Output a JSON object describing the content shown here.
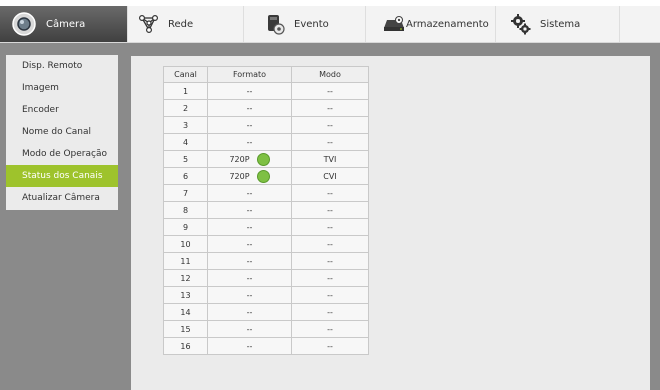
{
  "colors": {
    "accent": "#9ec32c",
    "status_ok": "#7ec043",
    "active_tab": "#4a4a4a"
  },
  "nav": [
    {
      "label": "Câmera",
      "icon": "camera-icon",
      "active": true
    },
    {
      "label": "Rede",
      "icon": "network-icon"
    },
    {
      "label": "Evento",
      "icon": "event-icon"
    },
    {
      "label": "Armazenamento",
      "icon": "storage-icon"
    },
    {
      "label": "Sistema",
      "icon": "gear-icon"
    }
  ],
  "sidebar": {
    "items": [
      {
        "label": "Disp. Remoto"
      },
      {
        "label": "Imagem"
      },
      {
        "label": "Encoder"
      },
      {
        "label": "Nome do Canal"
      },
      {
        "label": "Modo de Operação"
      },
      {
        "label": "Status dos Canais",
        "active": true
      },
      {
        "label": "Atualizar Câmera"
      }
    ]
  },
  "table": {
    "headers": [
      "Canal",
      "Formato",
      "Modo"
    ],
    "rows": [
      {
        "canal": "1",
        "formato": "--",
        "modo": "--"
      },
      {
        "canal": "2",
        "formato": "--",
        "modo": "--"
      },
      {
        "canal": "3",
        "formato": "--",
        "modo": "--"
      },
      {
        "canal": "4",
        "formato": "--",
        "modo": "--"
      },
      {
        "canal": "5",
        "formato": "720P",
        "modo": "TVI",
        "status": "ok"
      },
      {
        "canal": "6",
        "formato": "720P",
        "modo": "CVI",
        "status": "ok"
      },
      {
        "canal": "7",
        "formato": "--",
        "modo": "--"
      },
      {
        "canal": "8",
        "formato": "--",
        "modo": "--"
      },
      {
        "canal": "9",
        "formato": "--",
        "modo": "--"
      },
      {
        "canal": "10",
        "formato": "--",
        "modo": "--"
      },
      {
        "canal": "11",
        "formato": "--",
        "modo": "--"
      },
      {
        "canal": "12",
        "formato": "--",
        "modo": "--"
      },
      {
        "canal": "13",
        "formato": "--",
        "modo": "--"
      },
      {
        "canal": "14",
        "formato": "--",
        "modo": "--"
      },
      {
        "canal": "15",
        "formato": "--",
        "modo": "--"
      },
      {
        "canal": "16",
        "formato": "--",
        "modo": "--"
      }
    ]
  }
}
